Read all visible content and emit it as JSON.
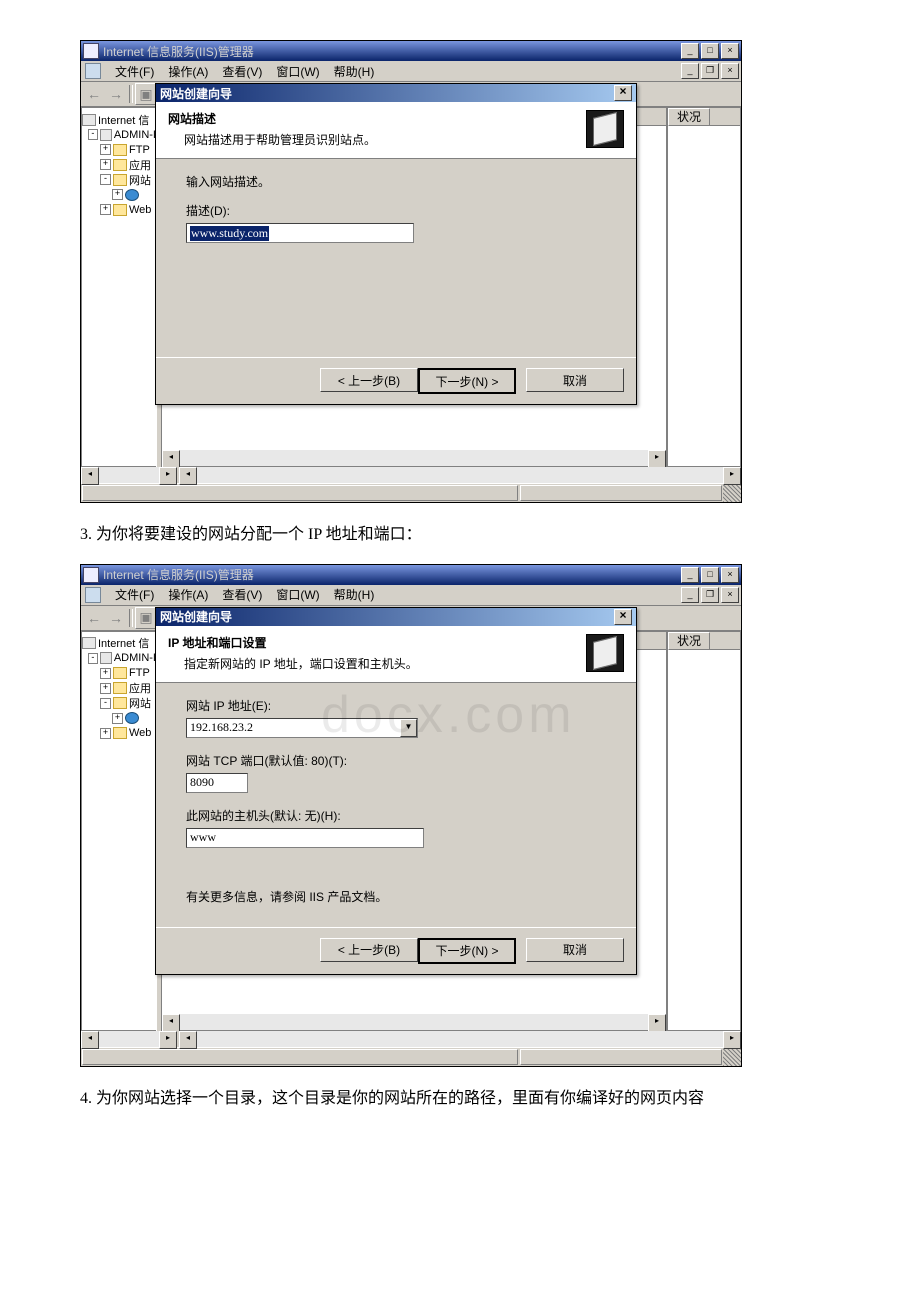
{
  "caption3": "3. 为你将要建设的网站分配一个 IP 地址和端口：",
  "caption4": "4. 为你网站选择一个目录，这个目录是你的网站所在的路径，里面有你编译好的网页内容",
  "watermark": "docx.com",
  "app": {
    "title": "Internet 信息服务(IIS)管理器",
    "menus": {
      "file": "文件(F)",
      "action": "操作(A)",
      "view": "查看(V)",
      "window": "窗口(W)",
      "help": "帮助(H)"
    },
    "rightHeader": "状况",
    "tree": {
      "root": "Internet 信",
      "server": "ADMIN-I",
      "ftp": "FTP",
      "apppool": "应用",
      "websites": "网站",
      "web": "Web"
    }
  },
  "wiz1": {
    "title": "网站创建向导",
    "headTitle": "网站描述",
    "headSub": "网站描述用于帮助管理员识别站点。",
    "prompt": "输入网站描述。",
    "descLabel": "描述(D):",
    "descValue": "www.study.com",
    "back": "< 上一步(B)",
    "next": "下一步(N) >",
    "cancel": "取消"
  },
  "wiz2": {
    "title": "网站创建向导",
    "headTitle": "IP 地址和端口设置",
    "headSub": "指定新网站的 IP 地址，端口设置和主机头。",
    "ipLabel": "网站 IP 地址(E):",
    "ipValue": "192.168.23.2",
    "portLabel": "网站 TCP 端口(默认值: 80)(T):",
    "portValue": "8090",
    "hostLabel": "此网站的主机头(默认: 无)(H):",
    "hostValue": "www",
    "moreInfo": "有关更多信息，请参阅 IIS 产品文档。",
    "back": "< 上一步(B)",
    "next": "下一步(N) >",
    "cancel": "取消"
  }
}
